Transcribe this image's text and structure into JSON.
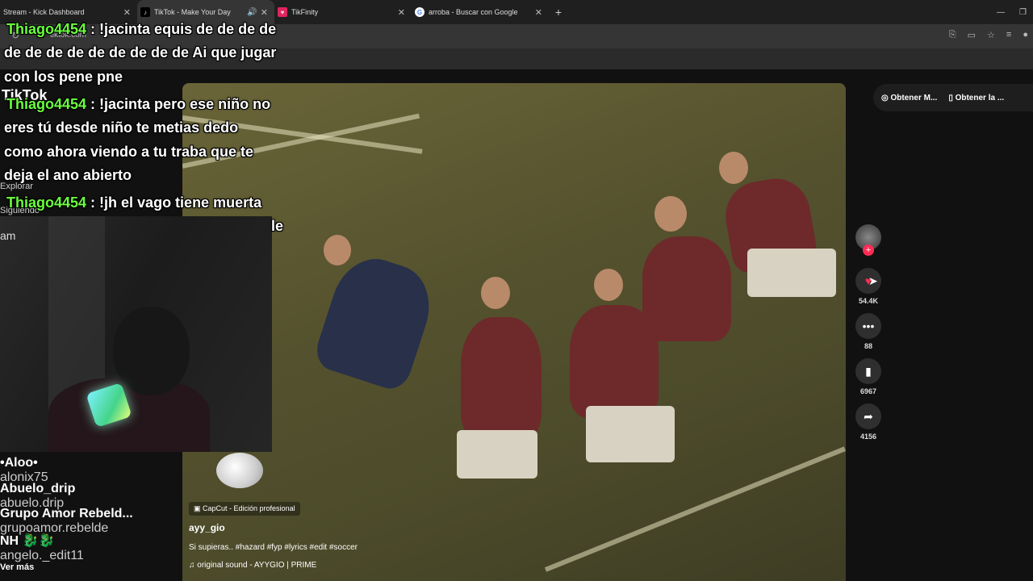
{
  "browser": {
    "tabs": [
      {
        "label": "Stream - Kick Dashboard",
        "icon": "kick-icon",
        "active": false
      },
      {
        "label": "TikTok - Make Your Day",
        "icon": "tiktok-icon",
        "active": true
      },
      {
        "label": "TikFinity",
        "icon": "tikfinity-icon",
        "active": false
      },
      {
        "label": "arroba - Buscar con Google",
        "icon": "google-icon",
        "active": false
      }
    ],
    "new_tab": "+",
    "url": "tiktok.com"
  },
  "page": {
    "logo": "TikTok",
    "side_links": [
      "Explorar",
      "Siguiendo"
    ],
    "top_buttons": [
      "Obtener M...",
      "Obtener la ..."
    ]
  },
  "chat": [
    {
      "user": "Thiago4454",
      "text": " : !jacinta equis de de de de"
    },
    {
      "user": "",
      "text": "de de de de de de de de de Ai que jugar"
    },
    {
      "user": "",
      "text": "con los pene pne"
    },
    {
      "user": "Thiago4454",
      "text": " : !jacinta pero ese niño no"
    },
    {
      "user": "",
      "text": "eres tú desde niño te metias dedo"
    },
    {
      "user": "",
      "text": "como ahora viendo a tu traba que te"
    },
    {
      "user": "",
      "text": "deja el ano abierto"
    },
    {
      "user": "Thiago4454",
      "text": " : !jh el vago tiene muerta"
    },
    {
      "user": "",
      "text": "le"
    }
  ],
  "webcam": {
    "overlay_text": "am"
  },
  "video": {
    "capcut_label": "CapCut - Edición profesional",
    "author": "ayy_gio",
    "description": "Si supieras.. #hazard #fyp #lyrics #edit #soccer",
    "sound": "original sound - AYYGIO | PRIME"
  },
  "actions": {
    "likes": "54.4K",
    "comments": "88",
    "saves": "6967",
    "shares": "4156"
  },
  "following": [
    {
      "name": "•Aloo•",
      "handle": "alonix75"
    },
    {
      "name": "Abuelo_drip",
      "handle": "abuelo.drip"
    },
    {
      "name": "Grupo Amor Rebeld...",
      "handle": "grupoamor.rebelde"
    },
    {
      "name": "NH 🐉🐉",
      "handle": "angelo._edit11"
    }
  ],
  "see_more": "Ver más",
  "colors": {
    "accent": "#fe2c55",
    "chat_username": "#6aff3c"
  }
}
